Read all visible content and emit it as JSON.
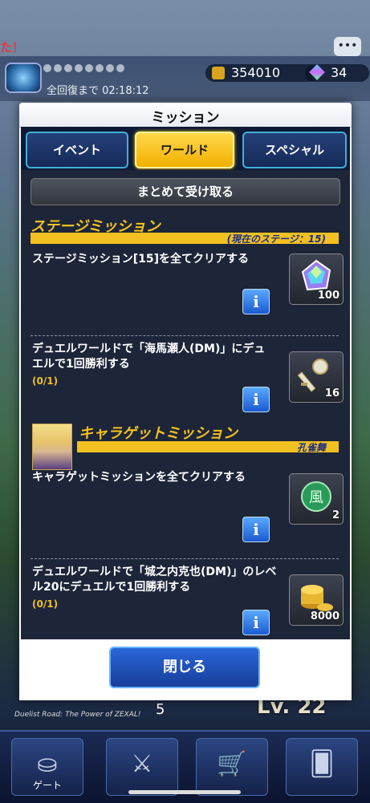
{
  "background": {
    "alert_text": "た！",
    "chat_icon": "chat-bubble-icon",
    "recovery_text": "全回復まで 02:18:12",
    "gold": "354010",
    "gems": "34",
    "deck_count": "5",
    "level_text": "Lv. 22",
    "banner_text": "Duelist Road: The Power of ZEXAL!",
    "nav": [
      {
        "label": "ゲート",
        "icon": "gate-icon"
      },
      {
        "label": "",
        "icon": "swords-icon"
      },
      {
        "label": "",
        "icon": "shop-cart-icon"
      },
      {
        "label": "",
        "icon": "cards-icon"
      }
    ]
  },
  "dialog": {
    "title": "ミッション",
    "tabs": [
      {
        "label": "イベント",
        "active": false
      },
      {
        "label": "ワールド",
        "active": true
      },
      {
        "label": "スペシャル",
        "active": false
      }
    ],
    "collect_all_label": "まとめて受け取る",
    "stage_section": {
      "title": "ステージミッション",
      "subtitle": "(現在のステージ：15)"
    },
    "chara_section": {
      "title": "キャラゲットミッション",
      "subtitle": "孔雀舞"
    },
    "missions": [
      {
        "text": "ステージミッション[15]を全てクリアする",
        "progress": "",
        "reward_icon": "crystal-gem-icon",
        "reward_qty": "100"
      },
      {
        "text": "デュエルワールドで「海馬瀬人(DM)」にデュエルで1回勝利する",
        "progress": "(0/1)",
        "reward_icon": "key-icon",
        "reward_qty": "16"
      },
      {
        "text": "キャラゲットミッションを全てクリアする",
        "progress": "",
        "reward_icon": "wind-orb-icon",
        "reward_qty": "2"
      },
      {
        "text": "デュエルワールドで「城之内克也(DM)」のレベル20にデュエルで1回勝利する",
        "progress": "(0/1)",
        "reward_icon": "gold-coins-icon",
        "reward_qty": "8000"
      }
    ],
    "info_label": "i",
    "close_label": "閉じる"
  }
}
